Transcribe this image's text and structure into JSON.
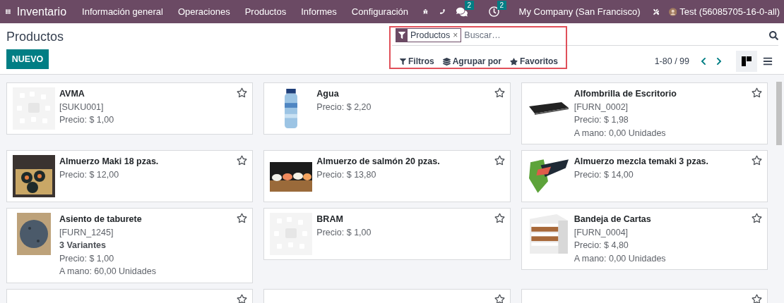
{
  "navbar": {
    "app_name": "Inventario",
    "menu": [
      "Información general",
      "Operaciones",
      "Productos",
      "Informes",
      "Configuración"
    ],
    "messages_badge": "2",
    "activities_badge": "2",
    "company": "My Company (San Francisco)",
    "user": "Test (56085705-16-0-all)"
  },
  "page_title": "Productos",
  "new_button": "NUEVO",
  "search": {
    "facet": "Productos",
    "facet_remove": "×",
    "placeholder": "Buscar…"
  },
  "search_options": [
    {
      "kind": "filter",
      "label": "Filtros"
    },
    {
      "kind": "group",
      "label": "Agrupar por"
    },
    {
      "kind": "favorite",
      "label": "Favoritos"
    }
  ],
  "pager": "1-80 / 99",
  "views": [
    {
      "kind": "kanban",
      "selected": true
    },
    {
      "kind": "list",
      "selected": false
    }
  ],
  "products": [
    {
      "name": "AVMA",
      "reference": "[SUKU001]",
      "price": "Precio: $ 1,00",
      "kind": "placeholder",
      "favorite": false
    },
    {
      "name": "Agua",
      "price": "Precio: $ 2,20",
      "kind": "picture",
      "favorite": false
    },
    {
      "name": "Alfombrilla de Escritorio",
      "reference": "[FURN_0002]",
      "price": "Precio: $ 1,98",
      "on_hand": "A mano: 0,00 Unidades",
      "kind": "picture",
      "favorite": false
    },
    {
      "name": "Almuerzo Maki 18 pzas.",
      "price": "Precio: $ 12,00",
      "kind": "picture",
      "favorite": false
    },
    {
      "name": "Almuerzo de salmón 20 pzas.",
      "price": "Precio: $ 13,80",
      "kind": "picture",
      "favorite": false
    },
    {
      "name": "Almuerzo mezcla temaki 3 pzas.",
      "price": "Precio: $ 14,00",
      "kind": "picture",
      "favorite": false
    },
    {
      "name": "Asiento de taburete",
      "reference": "[FURN_1245]",
      "variants": "3 Variantes",
      "price": "Precio: $ 1,00",
      "on_hand": "A mano: 60,00 Unidades",
      "kind": "picture",
      "favorite": false
    },
    {
      "name": "BRAM",
      "price": "Precio: $ 1,00",
      "kind": "placeholder",
      "favorite": false
    },
    {
      "name": "Bandeja de Cartas",
      "reference": "[FURN_0004]",
      "price": "Precio: $ 4,80",
      "on_hand": "A mano: 0,00 Unidades",
      "kind": "picture",
      "favorite": false
    },
    {
      "favorite": false
    },
    {
      "favorite": false
    },
    {
      "favorite": false
    }
  ]
}
